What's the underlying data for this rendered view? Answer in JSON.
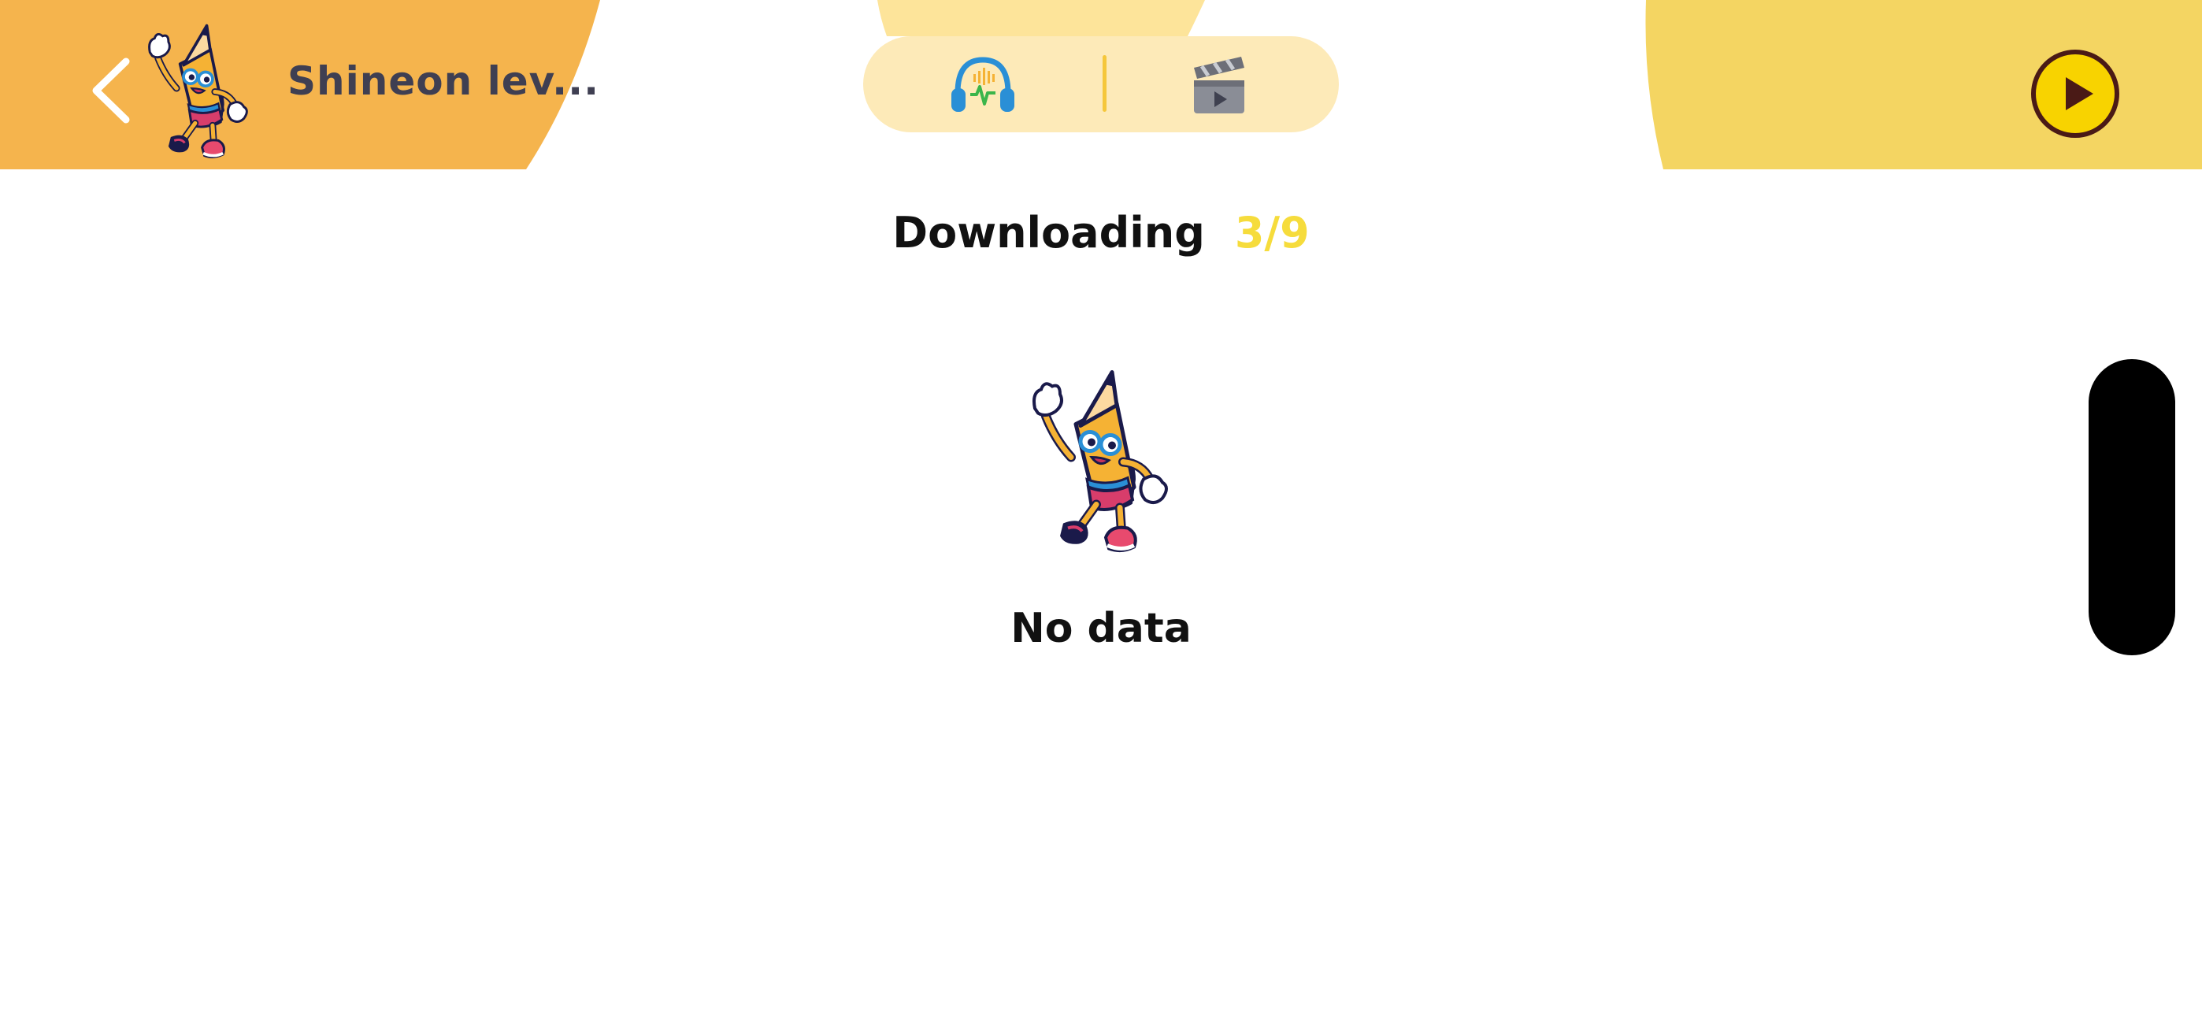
{
  "header": {
    "title": "Shineon lev...",
    "back_icon": "chevron-left-icon",
    "avatar_icon": "pencil-mascot-icon",
    "colors": {
      "left_shape": "#f5b44d",
      "right_shape": "#f4d562",
      "center_arc": "#fde49a"
    }
  },
  "mode_toggle": {
    "audio_icon": "headphones-icon",
    "video_icon": "clapperboard-icon",
    "background": "#fdeab8",
    "divider_color": "#f5c73b"
  },
  "play_button": {
    "icon": "play-icon",
    "color": "#f8d300"
  },
  "status": {
    "label": "Downloading",
    "count": "3/9",
    "count_color": "#f6dc3c"
  },
  "empty_state": {
    "text": "No data",
    "icon": "pencil-mascot-icon"
  }
}
